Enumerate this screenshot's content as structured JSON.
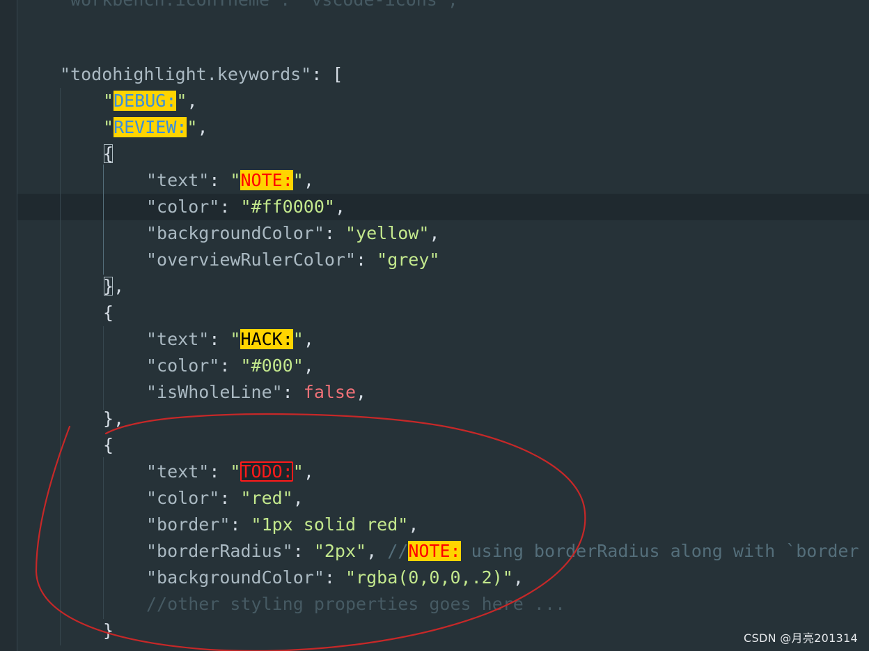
{
  "code": {
    "top_partial": "\"workbench.iconTheme\": \"vscode-icons\",",
    "key_todohighlight": "\"todohighlight.keywords\"",
    "open_array": ": [",
    "kw_debug": "DEBUG:",
    "kw_review": "REVIEW:",
    "open_brace": "{",
    "close_brace": "}",
    "close_brace_comma": "},",
    "obj1": {
      "text_key": "\"text\"",
      "text_value": "NOTE:",
      "color_key": "\"color\"",
      "color_value": "\"#ff0000\"",
      "bg_key": "\"backgroundColor\"",
      "bg_value": "\"yellow\"",
      "ruler_key": "\"overviewRulerColor\"",
      "ruler_value": "\"grey\""
    },
    "obj2": {
      "text_key": "\"text\"",
      "text_value": "HACK:",
      "color_key": "\"color\"",
      "color_value": "\"#000\"",
      "whole_key": "\"isWholeLine\"",
      "whole_value": "false"
    },
    "obj3": {
      "text_key": "\"text\"",
      "text_value": "TODO:",
      "color_key": "\"color\"",
      "color_value": "\"red\"",
      "border_key": "\"border\"",
      "border_value": "\"1px solid red\"",
      "radius_key": "\"borderRadius\"",
      "radius_value": "\"2px\"",
      "comment_prefix": "//",
      "comment_kw": "NOTE:",
      "comment_rest": " using borderRadius along with `border",
      "bg_key": "\"backgroundColor\"",
      "bg_value": "\"rgba(0,0,0,.2)\"",
      "trailing_comment": "//other styling properties goes here ..."
    }
  },
  "watermark": "CSDN @月亮201314",
  "colors": {
    "editor_bg": "#263238",
    "highlight_yellow": "#ffd400",
    "annotation_red": "#c62828"
  }
}
